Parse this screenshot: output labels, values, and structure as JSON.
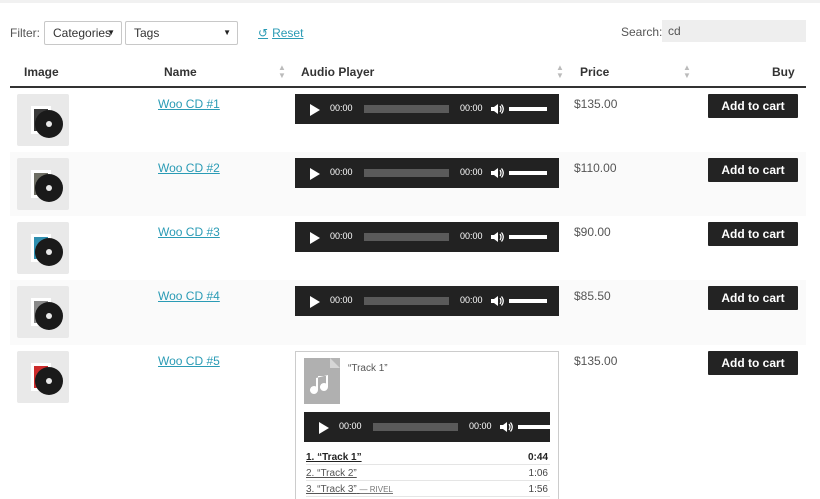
{
  "filter": {
    "label": "Filter:",
    "categories": "Categories",
    "tags": "Tags",
    "reset": "Reset"
  },
  "search": {
    "label": "Search:",
    "value": "cd"
  },
  "columns": {
    "image": "Image",
    "name": "Name",
    "audio": "Audio Player",
    "price": "Price",
    "buy": "Buy"
  },
  "player": {
    "current_time": "00:00",
    "duration": "00:00"
  },
  "button_label": "Add to cart",
  "products": [
    {
      "name": "Woo CD #1",
      "price": "$135.00",
      "color": "#3a3a3a"
    },
    {
      "name": "Woo CD #2",
      "price": "$110.00",
      "color": "#6e6e64"
    },
    {
      "name": "Woo CD #3",
      "price": "$90.00",
      "color": "#2f8fb0"
    },
    {
      "name": "Woo CD #4",
      "price": "$85.50",
      "color": "#8a8a8a"
    },
    {
      "name": "Woo CD #5",
      "price": "$135.00",
      "color": "#cc2b2b"
    }
  ],
  "playlist": {
    "current": "“Track 1”",
    "tracks": [
      {
        "title": "1. “Track 1”",
        "artist": "",
        "length": "0:44"
      },
      {
        "title": "2. “Track 2”",
        "artist": "",
        "length": "1:06"
      },
      {
        "title": "3. “Track 3”",
        "artist": "— RIVEL",
        "length": "1:56"
      }
    ]
  }
}
